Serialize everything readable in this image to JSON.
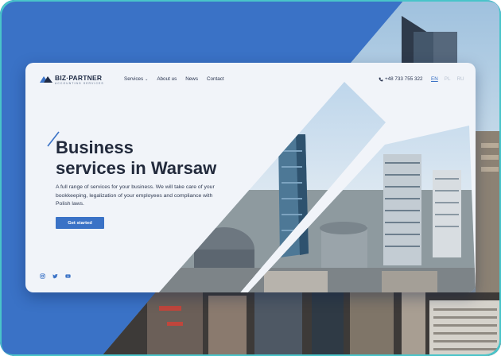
{
  "brand": {
    "name": "BIZ·PARTNER",
    "tagline": "ACCOUNTING SERVICES"
  },
  "nav": {
    "items": [
      {
        "label": "Services",
        "has_dropdown": true
      },
      {
        "label": "About us",
        "has_dropdown": false
      },
      {
        "label": "News",
        "has_dropdown": false
      },
      {
        "label": "Contact",
        "has_dropdown": false
      }
    ]
  },
  "header": {
    "phone": "+48 733 755 322",
    "phone_icon": "phone-icon",
    "languages": [
      {
        "code": "EN",
        "active": true
      },
      {
        "code": "PL",
        "active": false
      },
      {
        "code": "RU",
        "active": false
      }
    ]
  },
  "hero": {
    "title_line1": "Business",
    "title_line2": "services in Warsaw",
    "description": "A full range of services for your business. We will take care of your bookkeeping, legalization of your employees and compliance with Polish laws.",
    "cta_label": "Get started"
  },
  "social": [
    {
      "icon": "instagram-icon"
    },
    {
      "icon": "twitter-icon"
    },
    {
      "icon": "youtube-icon"
    }
  ],
  "colors": {
    "accent": "#3a72c6",
    "teal_edge": "#49c4c9",
    "heading": "#222a3c",
    "card_bg": "#f1f4f9"
  }
}
